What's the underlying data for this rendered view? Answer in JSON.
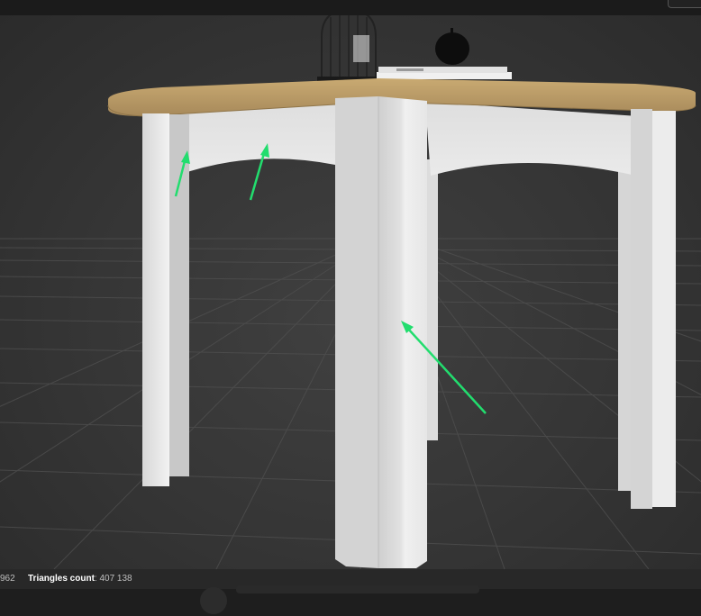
{
  "status": {
    "vertices_value": "962",
    "triangles_label": "Triangles count",
    "triangles_value": "407 138"
  },
  "scene": {
    "object": "table",
    "annotation_arrows": 3,
    "arrow_color": "#22dd6e",
    "tabletop_color": "#b89a63",
    "table_color": "#e4e4e4",
    "background_color": "#353535"
  }
}
